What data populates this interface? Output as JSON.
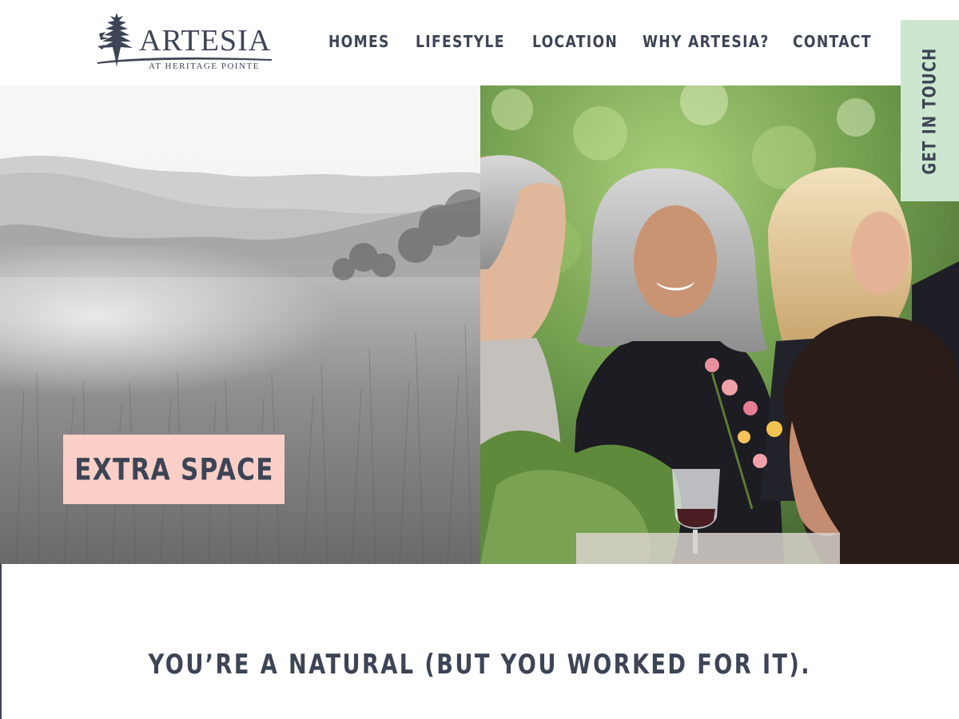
{
  "brand": {
    "name": "ARTESIA",
    "subtitle": "AT HERITAGE POINTE"
  },
  "nav": {
    "items": [
      {
        "label": "HOMES"
      },
      {
        "label": "LIFESTYLE"
      },
      {
        "label": "LOCATION"
      },
      {
        "label": "WHY ARTESIA?"
      },
      {
        "label": "CONTACT"
      }
    ]
  },
  "cta": {
    "label": "GET IN TOUCH"
  },
  "hero": {
    "badge": "EXTRA SPACE"
  },
  "tagline": "YOU’RE A NATURAL (BUT YOU WORKED FOR IT).",
  "colors": {
    "text": "#3d4456",
    "cta_background": "#cde6cf",
    "badge_background": "#f9cfc7"
  },
  "icons": {
    "logo": "pine-tree-icon"
  }
}
